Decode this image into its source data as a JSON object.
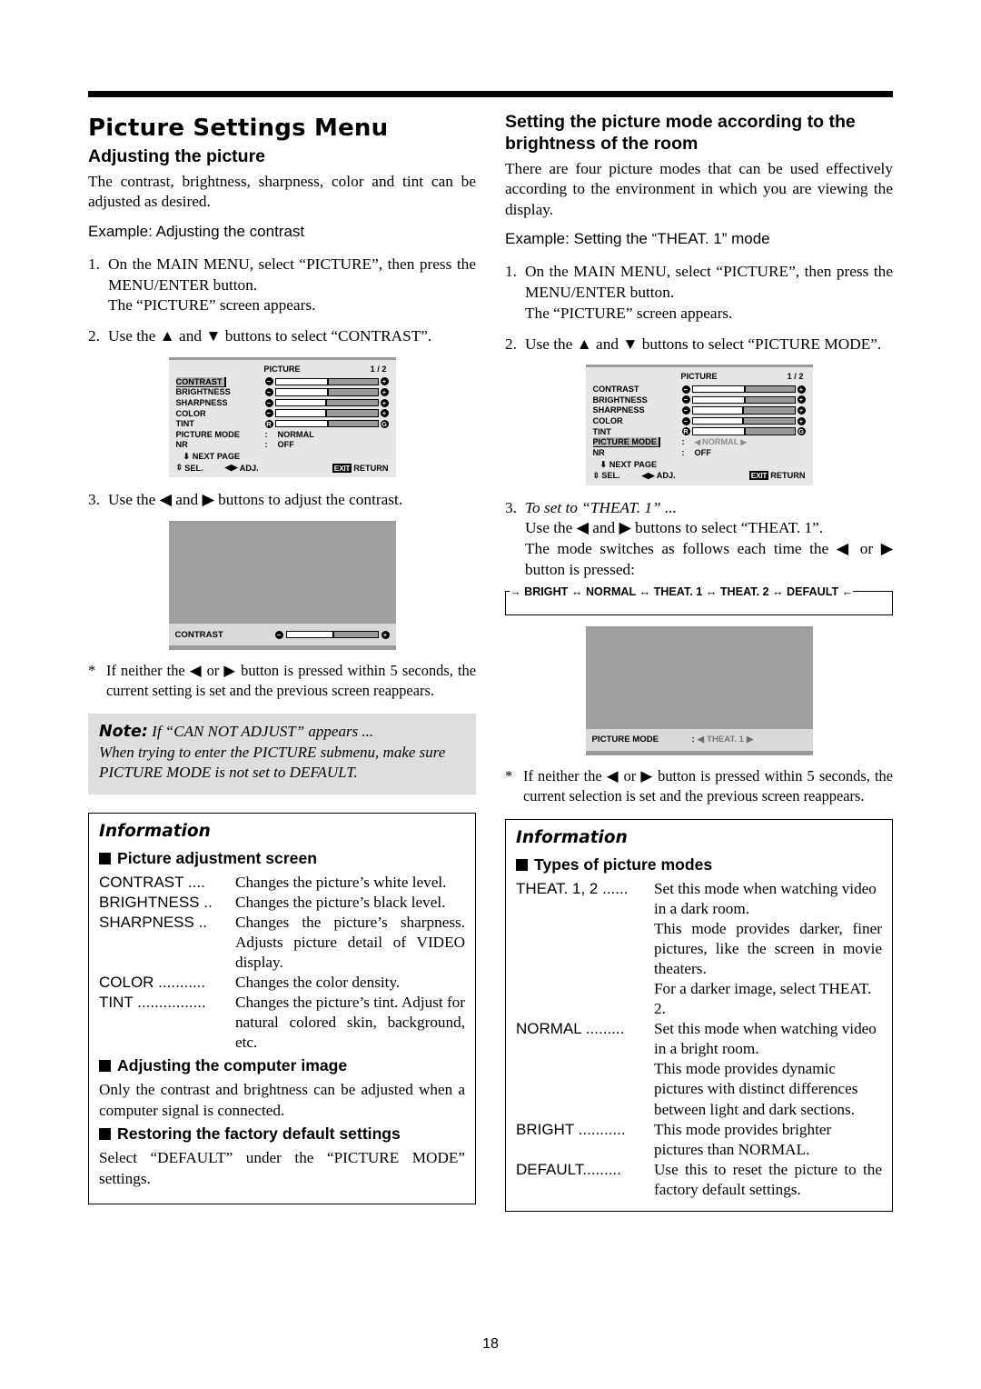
{
  "document": {
    "page_number": "18"
  },
  "left": {
    "main_title": "Picture Settings Menu",
    "subtitle": "Adjusting the picture",
    "intro": "The contrast, brightness, sharpness, color and tint can be adjusted as desired.",
    "example": "Example: Adjusting the contrast",
    "steps": [
      {
        "num": "1.",
        "line1": "On the MAIN MENU, select “PICTURE”, then press the MENU/ENTER button.",
        "line2": "The “PICTURE” screen appears."
      },
      {
        "num": "2.",
        "line1": "Use the ▲ and ▼ buttons to select “CONTRAST”."
      },
      {
        "num": "3.",
        "line1": "Use the ◀ and ▶ buttons to adjust the contrast."
      }
    ],
    "star_note": "If neither the ◀ or ▶ button is pressed within 5 seconds, the current setting is set and the previous screen reappears.",
    "note": {
      "label": "Note:",
      "headline": "If “CAN NOT ADJUST” appears ...",
      "body": "When trying to enter the PICTURE submenu, make sure PICTURE MODE is not set to DEFAULT."
    },
    "info": {
      "title": "Information",
      "section1_heading": "Picture adjustment screen",
      "definitions": [
        {
          "term": "CONTRAST ....",
          "desc": "Changes the picture’s white level."
        },
        {
          "term": "BRIGHTNESS ..",
          "desc": "Changes the picture’s black level."
        },
        {
          "term": "SHARPNESS ..",
          "desc": "Changes the picture’s sharpness. Adjusts picture detail of VIDEO display."
        },
        {
          "term": "COLOR ...........",
          "desc": "Changes the color density."
        },
        {
          "term": "TINT ................",
          "desc": "Changes the picture’s tint. Adjust for natural colored skin, background, etc."
        }
      ],
      "section2_heading": "Adjusting the computer image",
      "section2_body": "Only the contrast and brightness can be adjusted when a computer signal is connected.",
      "section3_heading": "Restoring the factory default settings",
      "section3_body": "Select “DEFAULT” under the “PICTURE MODE” settings."
    },
    "osd": {
      "title": "PICTURE",
      "page": "1 / 2",
      "rows": [
        {
          "label": "CONTRAST",
          "highlight": true,
          "type": "bar",
          "left_icon": "−",
          "right_icon": "+",
          "fill": 52
        },
        {
          "label": "BRIGHTNESS",
          "highlight": false,
          "type": "bar",
          "left_icon": "−",
          "right_icon": "+",
          "fill": 52
        },
        {
          "label": "SHARPNESS",
          "highlight": false,
          "type": "bar",
          "left_icon": "−",
          "right_icon": "+",
          "fill": 50
        },
        {
          "label": "COLOR",
          "highlight": false,
          "type": "bar",
          "left_icon": "−",
          "right_icon": "+",
          "fill": 50
        },
        {
          "label": "TINT",
          "highlight": false,
          "type": "bar",
          "left_icon": "R",
          "right_icon": "G",
          "fill": 52
        },
        {
          "label": "PICTURE MODE",
          "highlight": false,
          "type": "value",
          "value": "NORMAL",
          "selector": false
        },
        {
          "label": "NR",
          "highlight": false,
          "type": "value",
          "value": "OFF",
          "selector": false
        }
      ],
      "next_page": "NEXT PAGE",
      "foot_sel": "SEL.",
      "foot_adj": "ADJ.",
      "foot_exit": "EXIT",
      "foot_return": "RETURN"
    },
    "adjust_screen": {
      "label": "CONTRAST",
      "left_icon": "−",
      "right_icon": "+",
      "fill": 52
    }
  },
  "right": {
    "subtitle": "Setting the picture mode according to the brightness of the room",
    "intro": "There are four picture modes that can be used effectively according to the environment in which you are viewing the display.",
    "example": "Example: Setting the “THEAT. 1” mode",
    "steps": [
      {
        "num": "1.",
        "line1": "On the MAIN MENU, select “PICTURE”, then press the MENU/ENTER button.",
        "line2": "The “PICTURE” screen appears."
      },
      {
        "num": "2.",
        "line1": "Use the ▲ and ▼ buttons to select “PICTURE MODE”."
      },
      {
        "num": "3.",
        "italic_line": "To set to “THEAT. 1” ...",
        "line1": "Use the ◀ and ▶ buttons to select “THEAT. 1”.",
        "line2": "The mode switches as follows each time the ◀ or ▶ button is pressed:"
      }
    ],
    "cycle": "→ BRIGHT ↔ NORMAL ↔ THEAT. 1 ↔ THEAT. 2 ↔ DEFAULT ←",
    "star_note": "If neither the ◀ or ▶ button is pressed within 5 seconds, the current selection is set and the previous screen reappears.",
    "info": {
      "title": "Information",
      "section1_heading": "Types of picture modes",
      "definitions": [
        {
          "term": "THEAT. 1, 2 ......",
          "desc": "Set this mode when watching video in a dark room."
        },
        {
          "term": "",
          "desc": "This mode provides darker, finer pictures, like the screen in movie theaters."
        },
        {
          "term": "",
          "desc": "For a darker image, select THEAT. 2."
        },
        {
          "term": "NORMAL .........",
          "desc": "Set this mode when watching video in a bright room."
        },
        {
          "term": "",
          "desc": "This mode provides dynamic pictures with distinct differences between light and dark sections."
        },
        {
          "term": "BRIGHT ...........",
          "desc": "This mode provides brighter pictures than NORMAL."
        },
        {
          "term": "DEFAULT.........",
          "desc": "Use this to reset the picture to the factory default settings."
        }
      ]
    },
    "osd": {
      "title": "PICTURE",
      "page": "1 / 2",
      "rows": [
        {
          "label": "CONTRAST",
          "highlight": false,
          "type": "bar",
          "left_icon": "−",
          "right_icon": "+",
          "fill": 52
        },
        {
          "label": "BRIGHTNESS",
          "highlight": false,
          "type": "bar",
          "left_icon": "−",
          "right_icon": "+",
          "fill": 52
        },
        {
          "label": "SHARPNESS",
          "highlight": false,
          "type": "bar",
          "left_icon": "−",
          "right_icon": "+",
          "fill": 50
        },
        {
          "label": "COLOR",
          "highlight": false,
          "type": "bar",
          "left_icon": "−",
          "right_icon": "+",
          "fill": 50
        },
        {
          "label": "TINT",
          "highlight": false,
          "type": "bar",
          "left_icon": "R",
          "right_icon": "G",
          "fill": 52
        },
        {
          "label": "PICTURE MODE",
          "highlight": true,
          "type": "value",
          "value": "NORMAL",
          "selector": true
        },
        {
          "label": "NR",
          "highlight": false,
          "type": "value",
          "value": "OFF",
          "selector": false
        }
      ],
      "next_page": "NEXT PAGE",
      "foot_sel": "SEL.",
      "foot_adj": "ADJ.",
      "foot_exit": "EXIT",
      "foot_return": "RETURN"
    },
    "mode_screen": {
      "label": "PICTURE MODE",
      "value": "THEAT. 1"
    }
  }
}
